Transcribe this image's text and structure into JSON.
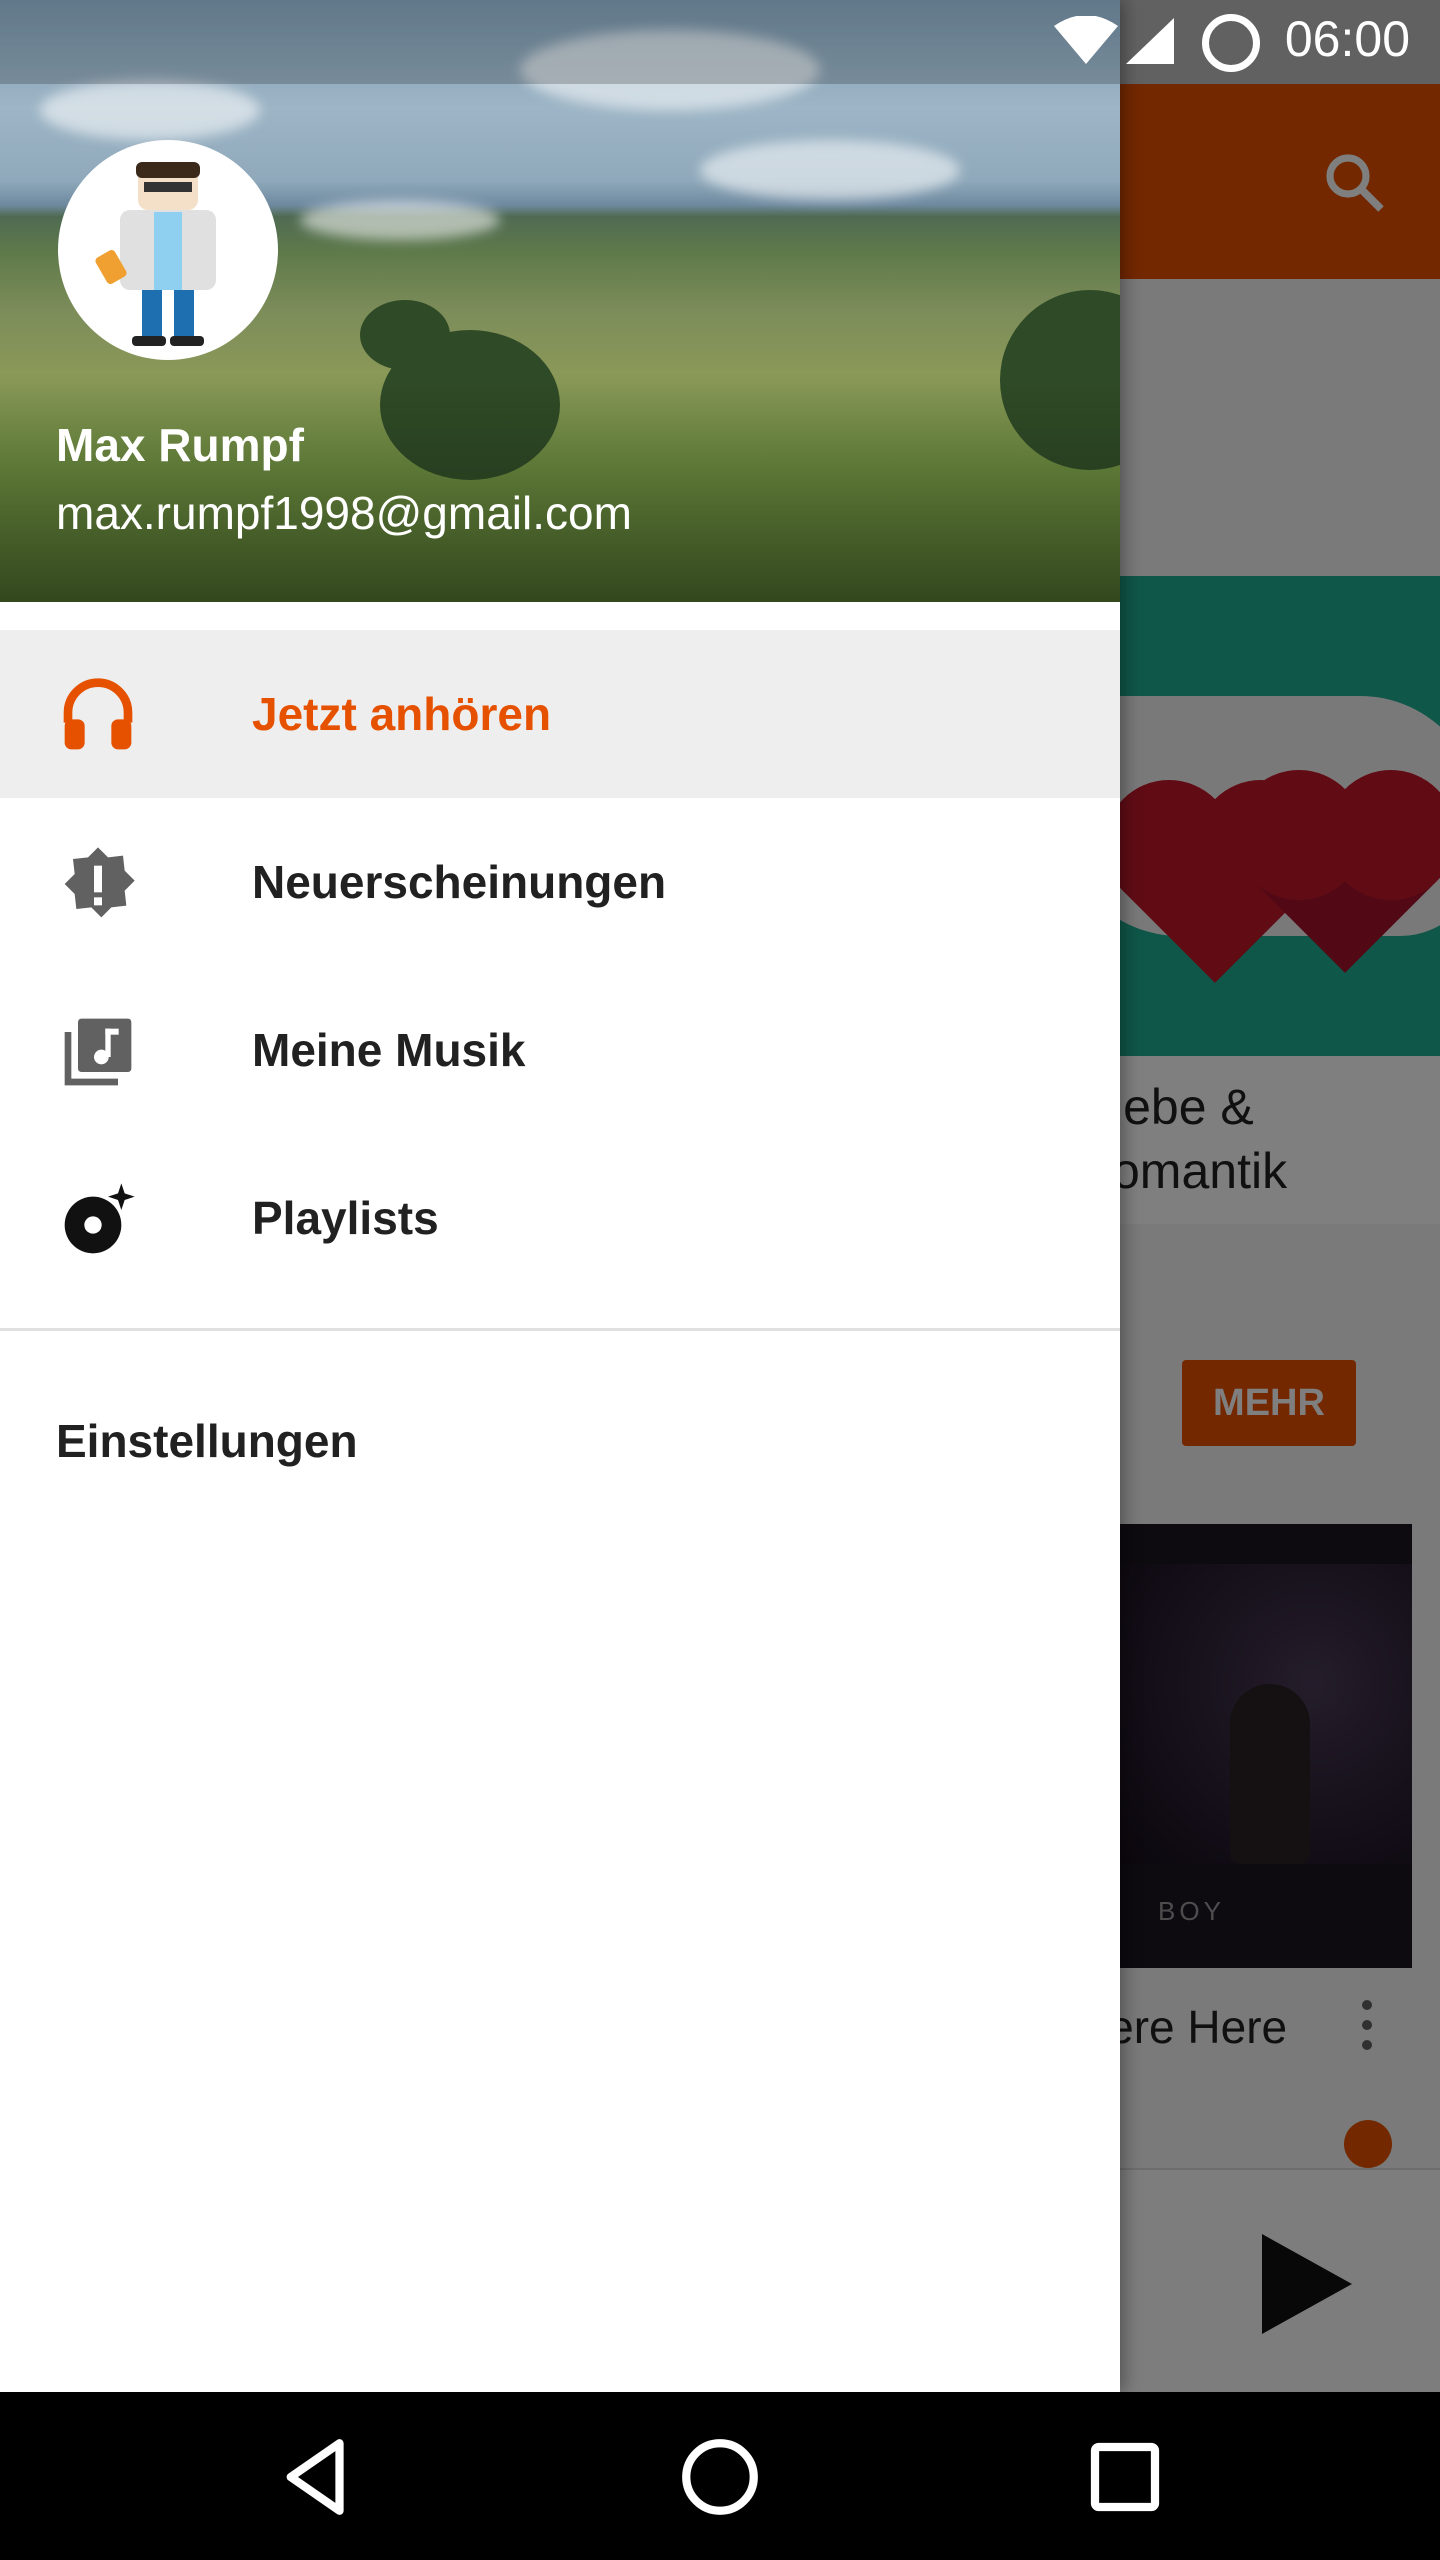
{
  "status_bar": {
    "time": "06:00"
  },
  "drawer": {
    "account": {
      "name": "Max Rumpf",
      "email": "max.rumpf1998@gmail.com"
    },
    "nav_items": [
      {
        "label": "Jetzt anhören",
        "icon": "headphones-icon",
        "active": true
      },
      {
        "label": "Neuerscheinungen",
        "icon": "new-release-icon",
        "active": false
      },
      {
        "label": "Meine Musik",
        "icon": "music-library-icon",
        "active": false
      },
      {
        "label": "Playlists",
        "icon": "playlist-disc-icon",
        "active": false
      }
    ],
    "settings_label": "Einstellungen"
  },
  "background": {
    "card_title_line1": "iebe &",
    "card_title_line2": "omantik",
    "more_button": "MEHR",
    "album_label": "BOY",
    "track_title": "Vere Here"
  },
  "colors": {
    "accent": "#e65100",
    "active_bg": "#eeeeee",
    "text": "#212121"
  }
}
